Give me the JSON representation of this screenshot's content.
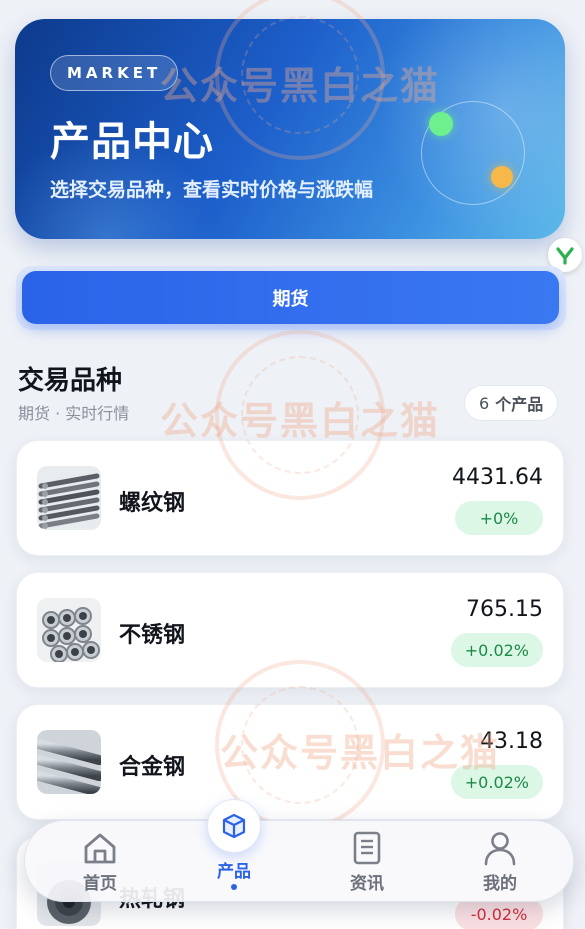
{
  "hero": {
    "badge": "MARKET",
    "title": "产品中心",
    "subtitle": "选择交易品种，查看实时价格与涨跌幅"
  },
  "category": {
    "selected": "期货"
  },
  "section": {
    "title": "交易品种",
    "subtitle": "期货 · 实时行情",
    "count_value": "6",
    "count_unit": "个产品"
  },
  "products": [
    {
      "name": "螺纹钢",
      "price": "4431.64",
      "change": "+0%",
      "trend": "up",
      "icon": "rebar-bundle-image"
    },
    {
      "name": "不锈钢",
      "price": "765.15",
      "change": "+0.02%",
      "trend": "up",
      "icon": "steel-pipes-image"
    },
    {
      "name": "合金钢",
      "price": "43.18",
      "change": "+0.02%",
      "trend": "up",
      "icon": "steel-rods-image"
    },
    {
      "name": "热轧钢",
      "price": "",
      "change": "-0.02%",
      "trend": "down",
      "icon": "steel-coil-image"
    }
  ],
  "nav": [
    {
      "label": "首页",
      "icon": "home-icon"
    },
    {
      "label": "产品",
      "icon": "cube-icon",
      "active": true
    },
    {
      "label": "资讯",
      "icon": "document-icon"
    },
    {
      "label": "我的",
      "icon": "user-icon"
    }
  ],
  "watermark": {
    "text": "公众号黑白之猫"
  },
  "colors": {
    "primary": "#2a63e8",
    "up_bg": "#dcf7e6",
    "up_text": "#1b8a46",
    "down_bg": "#fbe1e3",
    "down_text": "#cf2f3c"
  }
}
